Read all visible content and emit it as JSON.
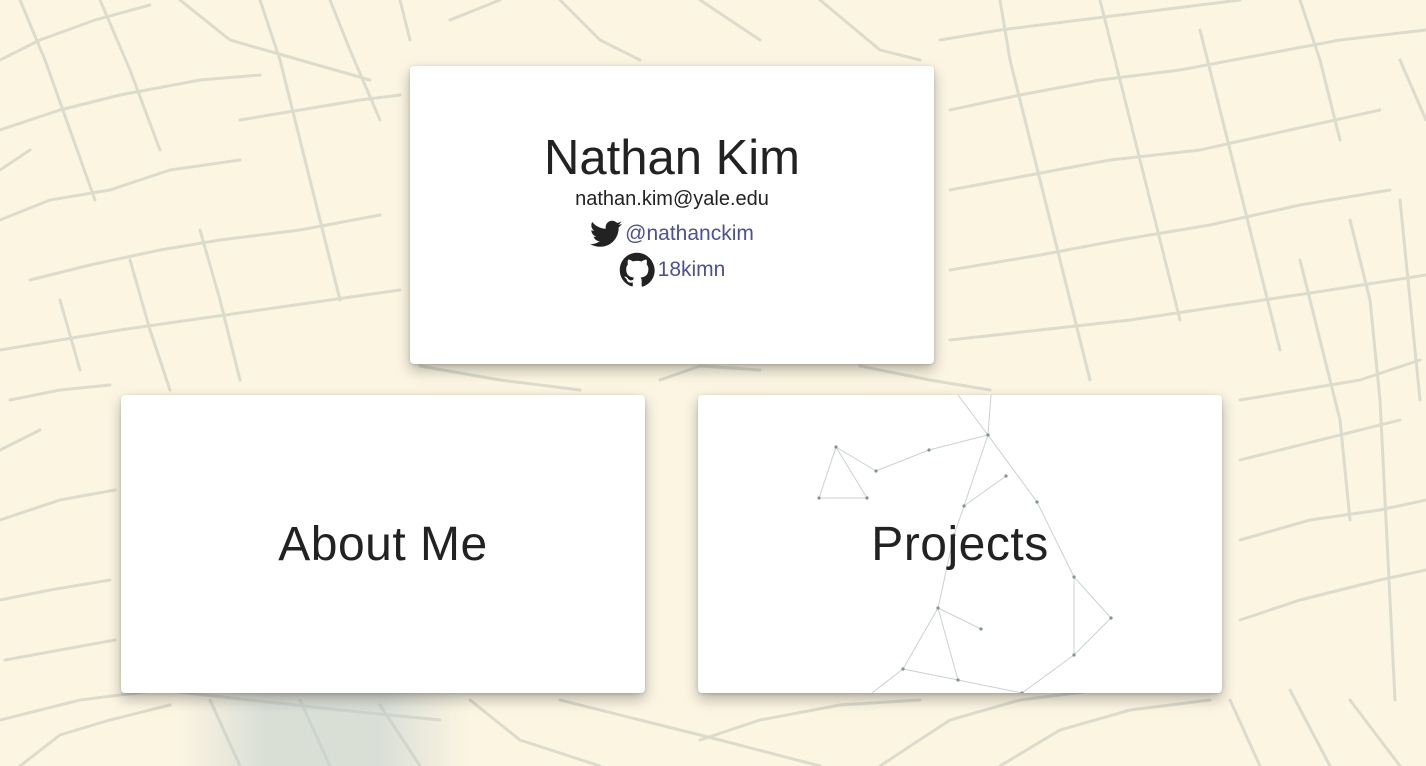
{
  "profile": {
    "name": "Nathan Kim",
    "email": "nathan.kim@yale.edu",
    "twitter_handle": "@nathanckim",
    "github_handle": "18kimn",
    "twitter_icon": "twitter-icon",
    "github_icon": "github-icon",
    "link_color": "#4a4fa0"
  },
  "cards": {
    "about_label": "About Me",
    "projects_label": "Projects"
  },
  "colors": {
    "background": "#fcf5e2",
    "lines": "#dfe0d0",
    "card": "#ffffff",
    "text": "#222222"
  }
}
